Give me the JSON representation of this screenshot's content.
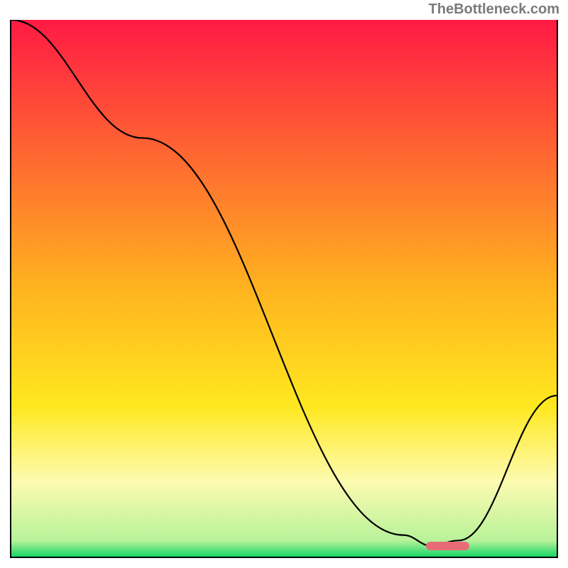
{
  "attribution": "TheBottleneck.com",
  "colors": {
    "gradient_top": "#ff1a44",
    "gradient_mid1": "#ff9a1f",
    "gradient_mid2": "#ffe81f",
    "gradient_mid3": "#fdfbb0",
    "gradient_bottom": "#17d666",
    "line": "#000000",
    "marker": "#e86b78",
    "axis": "#000000"
  },
  "chart_data": {
    "type": "line",
    "title": "",
    "xlabel": "",
    "ylabel": "",
    "xlim": [
      0,
      100
    ],
    "ylim": [
      0,
      100
    ],
    "series": [
      {
        "name": "bottleneck-curve",
        "x": [
          0,
          24,
          72,
          77,
          82,
          100
        ],
        "values": [
          100,
          78,
          4,
          2,
          3,
          30
        ]
      }
    ],
    "marker": {
      "x_start": 76,
      "x_end": 84,
      "y": 2
    },
    "gradient_stops": [
      {
        "offset": 0,
        "color": "#ff1a44"
      },
      {
        "offset": 0.5,
        "color": "#ffb31f"
      },
      {
        "offset": 0.72,
        "color": "#ffe81f"
      },
      {
        "offset": 0.86,
        "color": "#fdfbb0"
      },
      {
        "offset": 0.97,
        "color": "#b8f29a"
      },
      {
        "offset": 1.0,
        "color": "#17d666"
      }
    ]
  }
}
